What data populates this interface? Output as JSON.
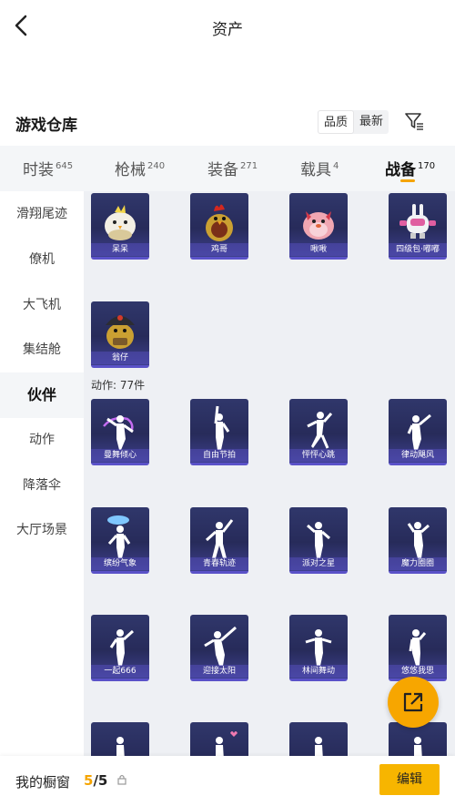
{
  "header": {
    "title": "资产"
  },
  "section": {
    "title": "游戏仓库",
    "sort_options": [
      "品质",
      "最新"
    ],
    "sort_active": "品质"
  },
  "tabs": [
    {
      "label": "时装",
      "count": "645"
    },
    {
      "label": "枪械",
      "count": "240"
    },
    {
      "label": "装备",
      "count": "271"
    },
    {
      "label": "载具",
      "count": "4"
    },
    {
      "label": "战备",
      "count": "170",
      "active": true
    }
  ],
  "sidebar": [
    {
      "label": "滑翔尾迹"
    },
    {
      "label": "僚机"
    },
    {
      "label": "大飞机"
    },
    {
      "label": "集结舱"
    },
    {
      "label": "伙伴",
      "active": true
    },
    {
      "label": "动作"
    },
    {
      "label": "降落伞"
    },
    {
      "label": "大厅场景"
    }
  ],
  "companions": [
    {
      "label": "呆呆",
      "icon": "white-chick-icon"
    },
    {
      "label": "鸡哥",
      "icon": "rooster-icon"
    },
    {
      "label": "啾啾",
      "icon": "pink-bird-icon"
    },
    {
      "label": "四级包·嘟嘟",
      "icon": "pink-robot-icon"
    },
    {
      "label": "翁仔",
      "icon": "helmet-chick-icon"
    }
  ],
  "actions_header": "动作: 77件",
  "actions": [
    {
      "label": "曼舞倾心"
    },
    {
      "label": "自由节拍"
    },
    {
      "label": "怦怦心跳"
    },
    {
      "label": "律动飓风"
    },
    {
      "label": "缤纷气象"
    },
    {
      "label": "青春轨迹"
    },
    {
      "label": "派对之星"
    },
    {
      "label": "魔力圈圈"
    },
    {
      "label": "一起666"
    },
    {
      "label": "迎接太阳"
    },
    {
      "label": "林间舞动"
    },
    {
      "label": "悠悠我思"
    },
    {
      "label": ""
    },
    {
      "label": ""
    },
    {
      "label": ""
    },
    {
      "label": ""
    }
  ],
  "bottom": {
    "showcase_label": "我的橱窗",
    "showcase_used": "5",
    "showcase_total": "/5",
    "edit_label": "编辑"
  },
  "colors": {
    "accent": "#f5a400",
    "card_bg": "#2b2f60",
    "card_border": "#5a52c8"
  }
}
